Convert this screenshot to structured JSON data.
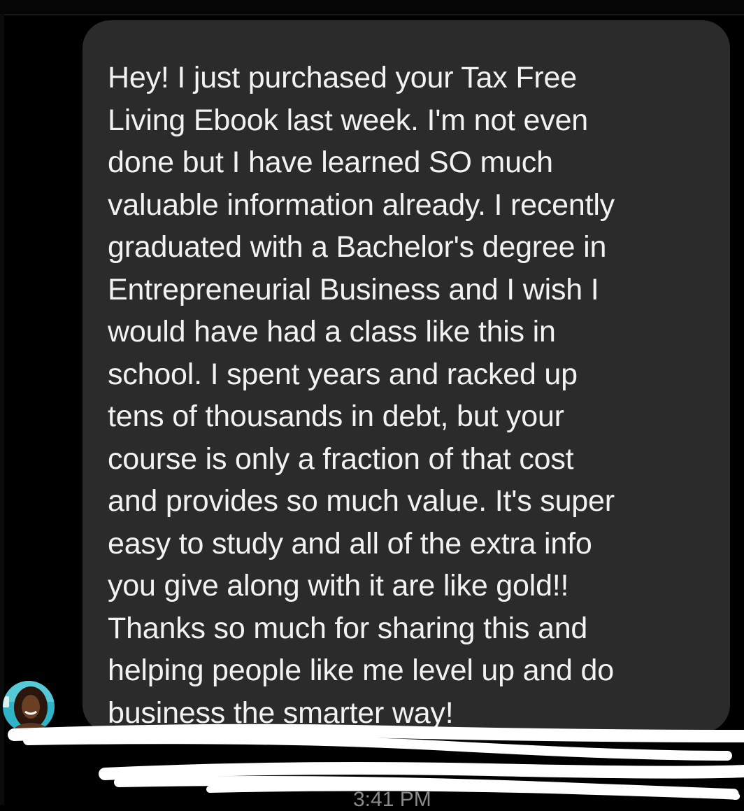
{
  "conversation": {
    "message": {
      "text": "Hey! I just purchased your Tax Free\nLiving Ebook last week. I'm not even\ndone but I have learned SO much\nvaluable information already. I recently\ngraduated with a Bachelor's degree in\nEntrepreneurial Business and I wish I\nwould have had a class like this in\nschool. I spent years and racked up\ntens of thousands in debt, but your\ncourse is only a fraction of that cost\nand provides so much value. It's super\neasy to study and all of the extra info\nyou give along with it are like gold!!\nThanks so much for sharing this and\nhelping people like me level up and do\nbusiness the smarter way!"
    },
    "timestamp": "3:41 PM"
  },
  "colors": {
    "background": "#000000",
    "bubble": "#2b2b2b",
    "message_text": "#f2f2f2",
    "redaction": "#ffffff"
  }
}
